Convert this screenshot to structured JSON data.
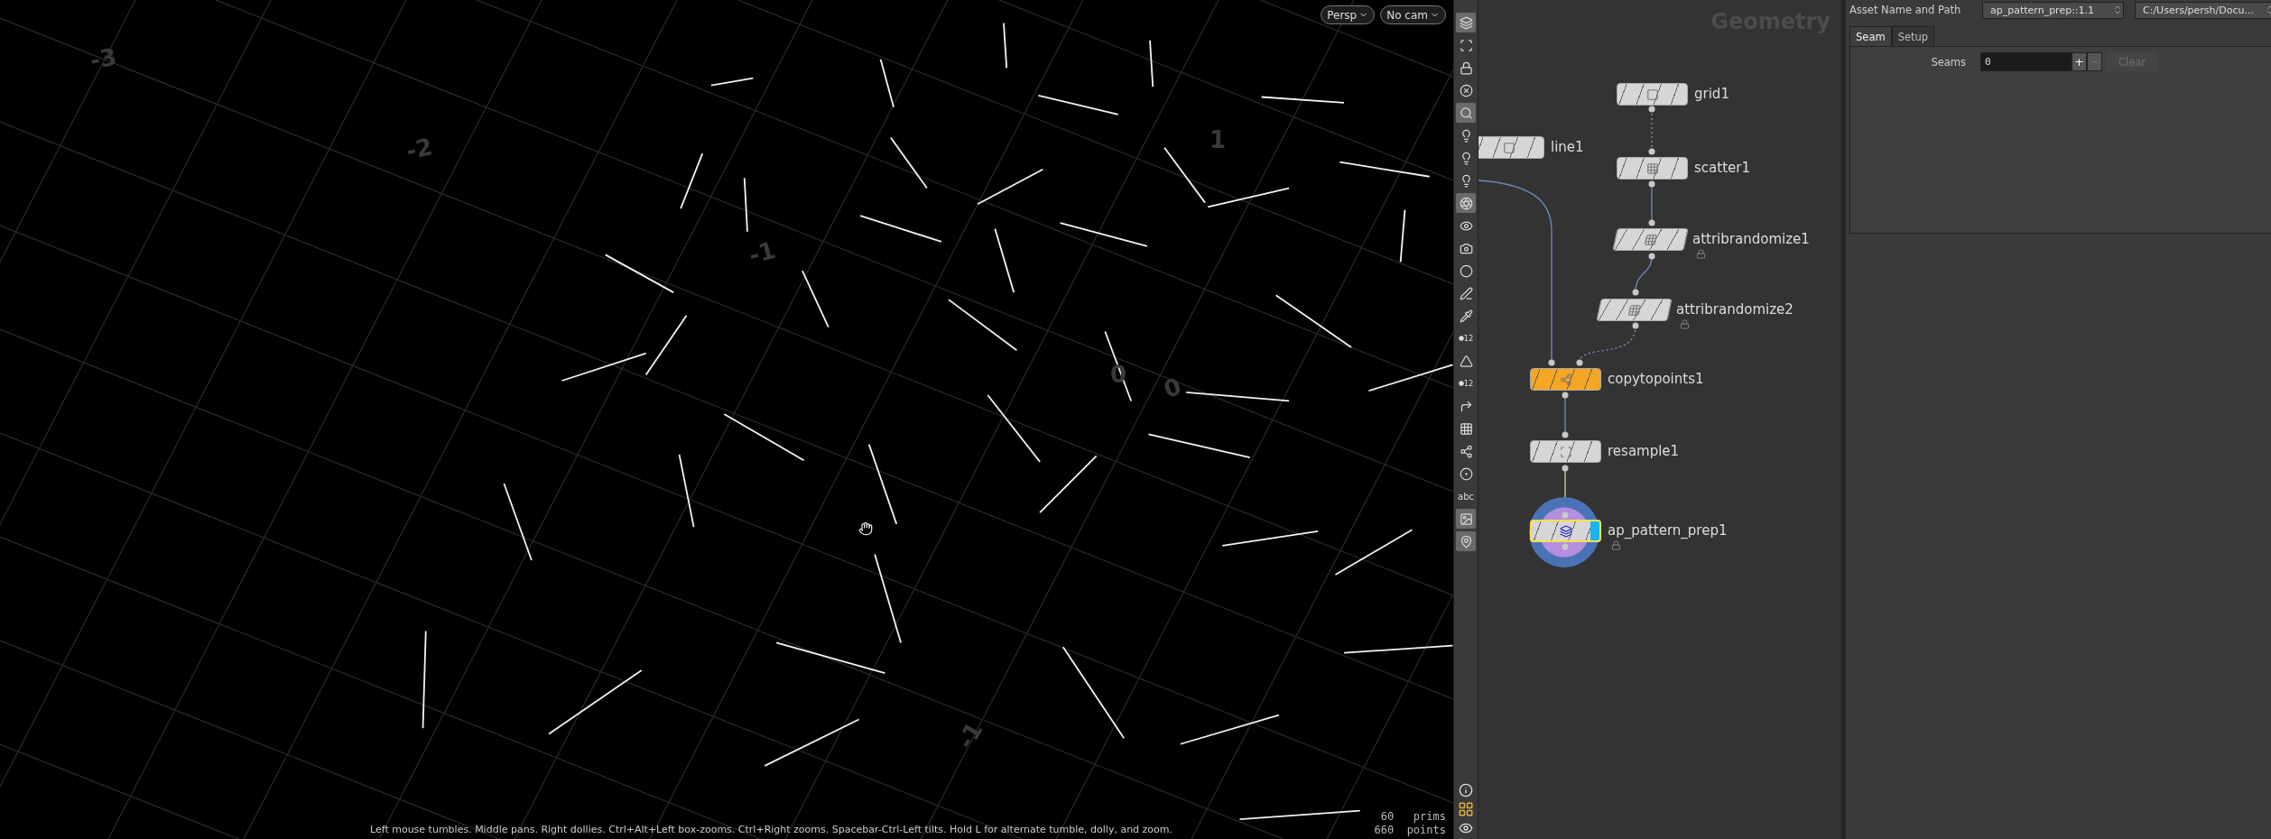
{
  "viewport": {
    "camera_buttons": [
      {
        "label": "Persp"
      },
      {
        "label": "No cam"
      }
    ],
    "grid_labels": [
      "-3",
      "-2",
      "-1",
      "0",
      "0",
      "1",
      "-1"
    ],
    "hint": "Left mouse tumbles. Middle pans. Right dollies. Ctrl+Alt+Left box-zooms. Ctrl+Right zooms. Spacebar-Ctrl-Left tilts. Hold L for alternate tumble, dolly, and zoom.",
    "stats": [
      {
        "value": "60",
        "label": "prims"
      },
      {
        "value": "660",
        "label": "points"
      }
    ]
  },
  "toolbar": [
    {
      "kind": "icon",
      "selected": true
    },
    {
      "kind": "icon",
      "selected": false
    },
    {
      "kind": "icon",
      "selected": false
    },
    {
      "kind": "icon",
      "selected": false
    },
    {
      "kind": "icon",
      "selected": true
    },
    {
      "kind": "icon",
      "selected": false
    },
    {
      "kind": "icon",
      "selected": false
    },
    {
      "kind": "icon",
      "selected": false
    },
    {
      "kind": "icon",
      "selected": true
    },
    {
      "kind": "icon",
      "selected": false
    },
    {
      "kind": "icon",
      "selected": false
    },
    {
      "kind": "icon",
      "selected": false
    },
    {
      "kind": "icon",
      "selected": false
    },
    {
      "kind": "icon",
      "selected": false
    },
    {
      "kind": "numbered",
      "label": "12",
      "selected": false
    },
    {
      "kind": "icon",
      "selected": false
    },
    {
      "kind": "numbered",
      "label": "12",
      "selected": false
    },
    {
      "kind": "icon",
      "selected": false
    },
    {
      "kind": "icon",
      "selected": false
    },
    {
      "kind": "icon",
      "selected": false
    },
    {
      "kind": "icon",
      "selected": false
    },
    {
      "kind": "text",
      "label": "abc",
      "selected": false
    },
    {
      "kind": "icon",
      "selected": true
    },
    {
      "kind": "icon",
      "selected": true
    }
  ],
  "network": {
    "title": "Geometry",
    "nodes": [
      {
        "name": "grid1",
        "kind": "normal",
        "selected": false,
        "locked": false,
        "display": false
      },
      {
        "name": "line1",
        "kind": "normal",
        "selected": false,
        "locked": false,
        "display": false
      },
      {
        "name": "scatter1",
        "kind": "normal",
        "selected": false,
        "locked": false,
        "display": false
      },
      {
        "name": "attribrandomize1",
        "kind": "slanted",
        "selected": false,
        "locked": true,
        "display": false
      },
      {
        "name": "attribrandomize2",
        "kind": "slanted",
        "selected": false,
        "locked": true,
        "display": false
      },
      {
        "name": "copytopoints1",
        "kind": "normal",
        "color": "#f5a623",
        "selected": false,
        "locked": false,
        "display": false
      },
      {
        "name": "resample1",
        "kind": "normal",
        "selected": false,
        "locked": false,
        "display": false
      },
      {
        "name": "ap_pattern_prep1",
        "kind": "normal",
        "selected": true,
        "locked": true,
        "display": true
      }
    ],
    "wires": [
      {
        "kind": "dotted"
      },
      {
        "kind": "solid"
      },
      {
        "kind": "solid"
      },
      {
        "kind": "dotted"
      },
      {
        "kind": "solid"
      },
      {
        "kind": "solid"
      },
      {
        "kind": "active"
      }
    ]
  },
  "parameters": {
    "asset_label": "Asset Name and Path",
    "asset_name": "ap_pattern_prep::1.1",
    "asset_path": "C:/Users/persh/Docu...",
    "tabs": [
      {
        "label": "Seam",
        "selected": true
      },
      {
        "label": "Setup",
        "selected": false
      }
    ],
    "fields": [
      {
        "label": "Seams",
        "value": "0"
      }
    ],
    "buttons": [
      {
        "label": "+",
        "disabled": false
      },
      {
        "label": "−",
        "disabled": true
      },
      {
        "label": "Clear",
        "disabled": true
      }
    ]
  }
}
